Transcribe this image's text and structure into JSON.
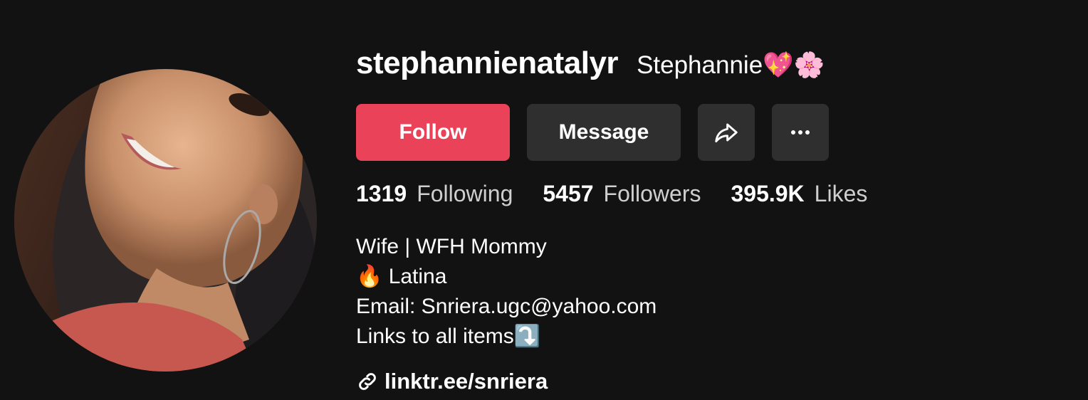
{
  "profile": {
    "username": "stephannienatalyr",
    "display_name": "Stephannie💖🌸",
    "avatar_icon": "profile-photo"
  },
  "actions": {
    "follow_label": "Follow",
    "message_label": "Message",
    "share_icon": "share-icon",
    "more_icon": "more-icon"
  },
  "stats": {
    "following_count": "1319",
    "following_label": "Following",
    "followers_count": "5457",
    "followers_label": "Followers",
    "likes_count": "395.9K",
    "likes_label": "Likes"
  },
  "bio": {
    "lines": [
      "Wife | WFH Mommy",
      "🔥 Latina",
      "Email: Snriera.ugc@yahoo.com",
      "Links to all items⤵️"
    ]
  },
  "link": {
    "text": "linktr.ee/snriera",
    "icon": "link-icon"
  },
  "colors": {
    "background": "#121212",
    "follow": "#ea4359",
    "button": "#2f2f2f",
    "muted_text": "#cfcfcf"
  }
}
